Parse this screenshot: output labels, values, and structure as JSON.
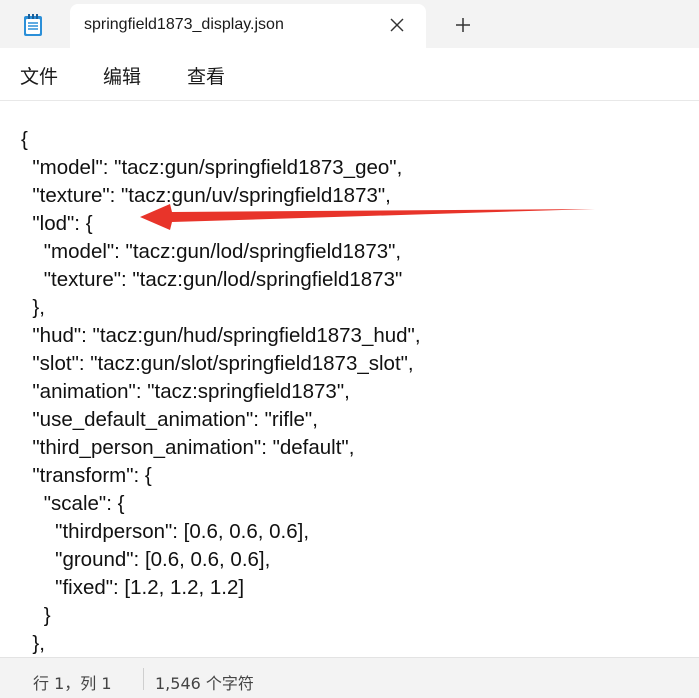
{
  "window": {
    "tab_title": "springfield1873_display.json",
    "icons": [
      "notepad-icon",
      "close-icon",
      "plus-icon"
    ]
  },
  "menu": {
    "items": [
      "文件",
      "编辑",
      "查看"
    ]
  },
  "editor": {
    "lines": [
      "{",
      "  \"model\": \"tacz:gun/springfield1873_geo\",",
      "  \"texture\": \"tacz:gun/uv/springfield1873\",",
      "  \"lod\": {",
      "    \"model\": \"tacz:gun/lod/springfield1873\",",
      "    \"texture\": \"tacz:gun/lod/springfield1873\"",
      "  },",
      "  \"hud\": \"tacz:gun/hud/springfield1873_hud\",",
      "  \"slot\": \"tacz:gun/slot/springfield1873_slot\",",
      "  \"animation\": \"tacz:springfield1873\",",
      "  \"use_default_animation\": \"rifle\",",
      "  \"third_person_animation\": \"default\",",
      "  \"transform\": {",
      "    \"scale\": {",
      "      \"thirdperson\": [0.6, 0.6, 0.6],",
      "      \"ground\": [0.6, 0.6, 0.6],",
      "      \"fixed\": [1.2, 1.2, 1.2]",
      "    }",
      "  },"
    ],
    "annotation_color": "#e8342a"
  },
  "status": {
    "position": "行 1，列 1",
    "char_count": "1,546 个字符"
  }
}
